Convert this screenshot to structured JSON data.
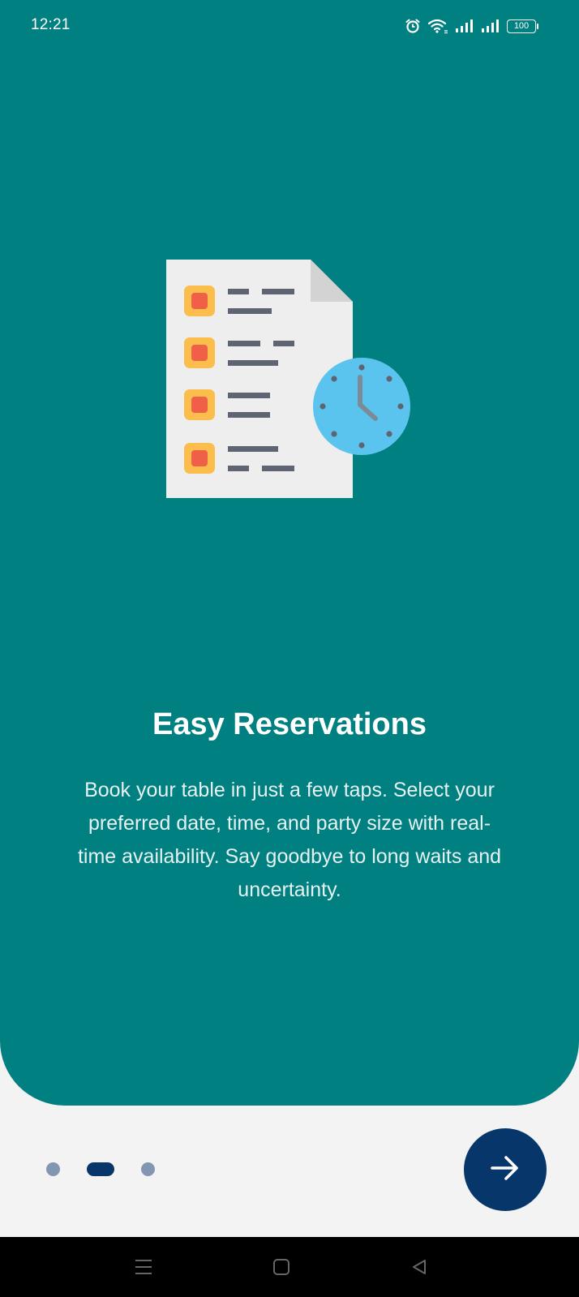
{
  "status_bar": {
    "time": "12:21",
    "battery": "100",
    "icons": [
      "alarm-icon",
      "wifi-icon",
      "signal-icon",
      "signal-icon",
      "battery-icon"
    ]
  },
  "illustration": {
    "icon": "reservation-list-clock-icon",
    "colors": {
      "paper": "#eeeeee",
      "fold": "#d3d3d3",
      "checkbox_outer": "#fbbd4c",
      "checkbox_inner": "#f05f48",
      "line": "#5f6473",
      "clock": "#5bc4ee",
      "clock_hand": "#7c8b98"
    }
  },
  "onboarding": {
    "title": "Easy Reservations",
    "description": "Book your table in just a few taps. Select your preferred date, time, and party size with real-time availability. Say goodbye to long waits and uncertainty."
  },
  "pager": {
    "total": 3,
    "active_index": 1
  },
  "next_button": {
    "icon": "arrow-right-icon"
  },
  "nav_bar": {
    "icons": [
      "menu-icon",
      "home-icon",
      "back-icon"
    ]
  },
  "colors": {
    "hero": "#008080",
    "accent": "#07366a",
    "inactive_dot": "#8296b2",
    "background": "#f3f3f4"
  }
}
